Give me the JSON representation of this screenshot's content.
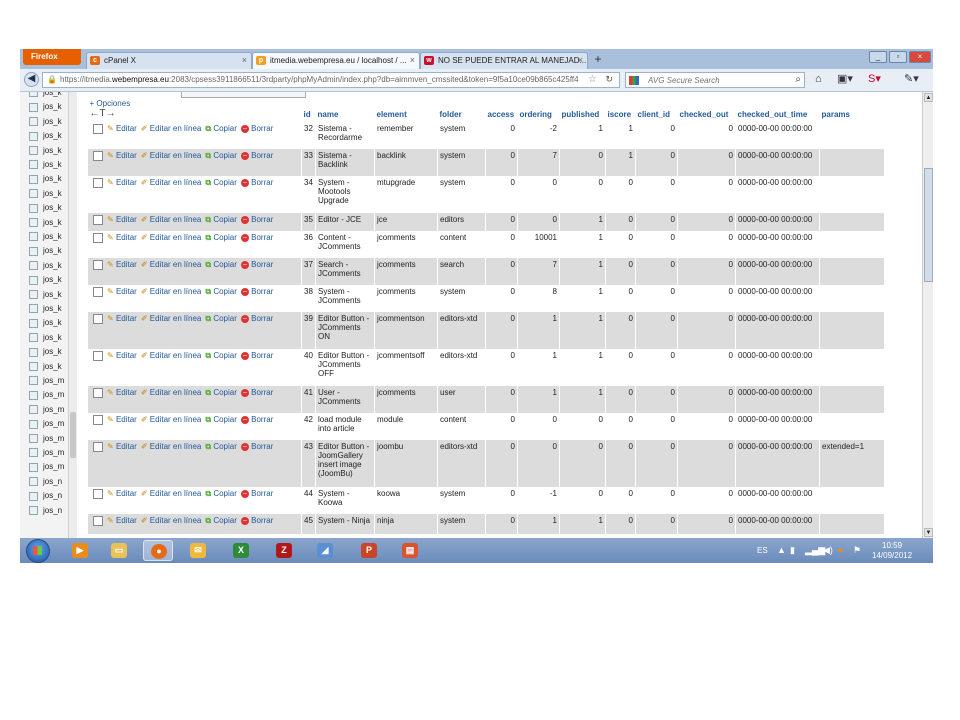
{
  "browser": {
    "menu_button": "Firefox",
    "tabs": [
      {
        "label": "cPanel X",
        "icon": "cpanel-icon"
      },
      {
        "label": "itmedia.webempresa.eu / localhost / ...",
        "icon": "phpmyadmin-icon"
      },
      {
        "label": "NO SE PUEDE ENTRAR AL MANEJAD...",
        "icon": "webempresa-icon"
      }
    ],
    "new_tab": "+",
    "url_prefix": "https://itmedia.",
    "url_domain": "webempresa.eu",
    "url_rest": ":2083/cpsess3911866511/3rdparty/phpMyAdmin/index.php?db=aimmven_cmssited&token=9f5a10ce09b865c425ff4",
    "search_placeholder": "AVG Secure Search"
  },
  "sidebar": {
    "items": [
      "jos_k",
      "jos_k",
      "jos_k",
      "jos_k",
      "jos_k",
      "jos_k",
      "jos_k",
      "jos_k",
      "jos_k",
      "jos_k",
      "jos_k",
      "jos_k",
      "jos_k",
      "jos_k",
      "jos_k",
      "jos_k",
      "jos_k",
      "jos_k",
      "jos_k",
      "jos_k",
      "jos_m",
      "jos_m",
      "jos_m",
      "jos_m",
      "jos_m",
      "jos_m",
      "jos_m",
      "jos_n",
      "jos_n",
      "jos_n"
    ]
  },
  "main": {
    "options_link": "+ Opciones",
    "actions": {
      "edit": "Editar",
      "inline": "Editar en línea",
      "copy": "Copiar",
      "delete": "Borrar"
    },
    "columns": [
      "id",
      "name",
      "element",
      "folder",
      "access",
      "ordering",
      "published",
      "iscore",
      "client_id",
      "checked_out",
      "checked_out_time",
      "params"
    ],
    "rows": [
      {
        "id": "32",
        "name": "Sistema - Recordarme",
        "element": "remember",
        "folder": "system",
        "access": "0",
        "ordering": "-2",
        "published": "1",
        "iscore": "1",
        "client_id": "0",
        "checked_out": "0",
        "checked_out_time": "0000-00-00 00:00:00",
        "params": ""
      },
      {
        "id": "33",
        "name": "Sistema - Backlink",
        "element": "backlink",
        "folder": "system",
        "access": "0",
        "ordering": "7",
        "published": "0",
        "iscore": "1",
        "client_id": "0",
        "checked_out": "0",
        "checked_out_time": "0000-00-00 00:00:00",
        "params": ""
      },
      {
        "id": "34",
        "name": "System - Mootools Upgrade",
        "element": "mtupgrade",
        "folder": "system",
        "access": "0",
        "ordering": "0",
        "published": "0",
        "iscore": "0",
        "client_id": "0",
        "checked_out": "0",
        "checked_out_time": "0000-00-00 00:00:00",
        "params": ""
      },
      {
        "id": "35",
        "name": "Editor - JCE",
        "element": "jce",
        "folder": "editors",
        "access": "0",
        "ordering": "0",
        "published": "1",
        "iscore": "0",
        "client_id": "0",
        "checked_out": "0",
        "checked_out_time": "0000-00-00 00:00:00",
        "params": ""
      },
      {
        "id": "36",
        "name": "Content - JComments",
        "element": "jcomments",
        "folder": "content",
        "access": "0",
        "ordering": "10001",
        "published": "1",
        "iscore": "0",
        "client_id": "0",
        "checked_out": "0",
        "checked_out_time": "0000-00-00 00:00:00",
        "params": ""
      },
      {
        "id": "37",
        "name": "Search - JComments",
        "element": "jcomments",
        "folder": "search",
        "access": "0",
        "ordering": "7",
        "published": "1",
        "iscore": "0",
        "client_id": "0",
        "checked_out": "0",
        "checked_out_time": "0000-00-00 00:00:00",
        "params": ""
      },
      {
        "id": "38",
        "name": "System - JComments",
        "element": "jcomments",
        "folder": "system",
        "access": "0",
        "ordering": "8",
        "published": "1",
        "iscore": "0",
        "client_id": "0",
        "checked_out": "0",
        "checked_out_time": "0000-00-00 00:00:00",
        "params": ""
      },
      {
        "id": "39",
        "name": "Editor Button - JComments ON",
        "element": "jcommentson",
        "folder": "editors-xtd",
        "access": "0",
        "ordering": "1",
        "published": "1",
        "iscore": "0",
        "client_id": "0",
        "checked_out": "0",
        "checked_out_time": "0000-00-00 00:00:00",
        "params": ""
      },
      {
        "id": "40",
        "name": "Editor Button - JComments OFF",
        "element": "jcommentsoff",
        "folder": "editors-xtd",
        "access": "0",
        "ordering": "1",
        "published": "1",
        "iscore": "0",
        "client_id": "0",
        "checked_out": "0",
        "checked_out_time": "0000-00-00 00:00:00",
        "params": ""
      },
      {
        "id": "41",
        "name": "User - JComments",
        "element": "jcomments",
        "folder": "user",
        "access": "0",
        "ordering": "1",
        "published": "1",
        "iscore": "0",
        "client_id": "0",
        "checked_out": "0",
        "checked_out_time": "0000-00-00 00:00:00",
        "params": ""
      },
      {
        "id": "42",
        "name": "load module into article",
        "element": "module",
        "folder": "content",
        "access": "0",
        "ordering": "0",
        "published": "0",
        "iscore": "0",
        "client_id": "0",
        "checked_out": "0",
        "checked_out_time": "0000-00-00 00:00:00",
        "params": ""
      },
      {
        "id": "43",
        "name": "Editor Button - JoomGallery insert image (JoomBu)",
        "element": "joombu",
        "folder": "editors-xtd",
        "access": "0",
        "ordering": "0",
        "published": "0",
        "iscore": "0",
        "client_id": "0",
        "checked_out": "0",
        "checked_out_time": "0000-00-00 00:00:00",
        "params": "extended=1"
      },
      {
        "id": "44",
        "name": "System - Koowa",
        "element": "koowa",
        "folder": "system",
        "access": "0",
        "ordering": "-1",
        "published": "0",
        "iscore": "0",
        "client_id": "0",
        "checked_out": "0",
        "checked_out_time": "0000-00-00 00:00:00",
        "params": ""
      },
      {
        "id": "45",
        "name": "System - Ninja",
        "element": "ninja",
        "folder": "system",
        "access": "0",
        "ordering": "1",
        "published": "1",
        "iscore": "0",
        "client_id": "0",
        "checked_out": "0",
        "checked_out_time": "0000-00-00 00:00:00",
        "params": ""
      }
    ]
  },
  "taskbar": {
    "language": "ES",
    "time": "10:59",
    "date": "14/09/2012"
  }
}
